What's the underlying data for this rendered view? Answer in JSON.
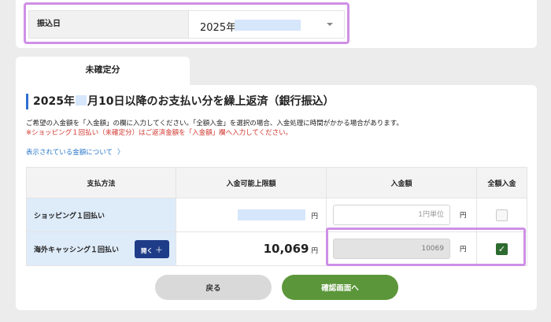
{
  "transfer_date": {
    "label": "振込日",
    "year_text": "2025年"
  },
  "tab": {
    "label": "未確定分"
  },
  "section": {
    "heading_prefix": "2025年",
    "heading_suffix": "月10日以降のお支払い分を繰上返済（銀行振込）",
    "instruction": "ご希望の入金額を「入金額」の欄に入力してください。「全額入金」を選択の場合、入金処理に時間がかかる場合があります。",
    "warning": "※ショッピング１回払い（未確定分）はご返済金額を「入金額」欄へ入力してください。",
    "amount_link": "表示されている金額について",
    "amount_link_chevron": "〉"
  },
  "table": {
    "headers": [
      "支払方法",
      "入金可能上限額",
      "入金額",
      "全額入金"
    ],
    "currency": "円",
    "rows": [
      {
        "method": "ショッピング１回払い",
        "limit": "",
        "input_placeholder": "1円単位",
        "input_value": "",
        "full_payment": false
      },
      {
        "method": "海外キャッシング１回払い",
        "open_button": "開く",
        "open_button_icon": "＋",
        "limit": "10,069",
        "input_value": "10069",
        "full_payment": true
      }
    ]
  },
  "buttons": {
    "back": "戻る",
    "confirm": "確認画面へ"
  },
  "colors": {
    "highlight": "#cf8fe6",
    "accent_blue": "#2f6fd0",
    "confirm_green": "#5b963a",
    "warning_red": "#d0342c"
  }
}
